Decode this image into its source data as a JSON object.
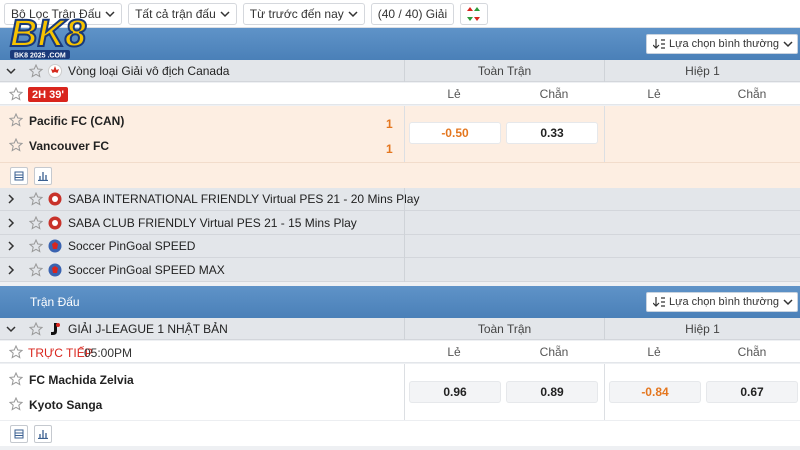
{
  "filters": {
    "match_filter": "Bộ Lọc Trận Đấu",
    "all_matches": "Tất cả trận đấu",
    "time_order": "Từ trước đến nay",
    "league_count": "(40 / 40) Giải"
  },
  "logo": {
    "text": "BK8",
    "sub": "BK8 2025 .COM"
  },
  "section1": {
    "sort_select": "Lựa chọn bình thường",
    "league": {
      "name": "Vòng loại Giải vô địch Canada",
      "col_full": "Toàn Trận",
      "col_half": "Hiệp 1"
    },
    "subhead": {
      "live_time": "2H 39'",
      "le": "Lẻ",
      "chan": "Chẵn",
      "le2": "Lẻ",
      "chan2": "Chẵn"
    },
    "match": {
      "home": "Pacific FC (CAN)",
      "away": "Vancouver FC",
      "home_score": "1",
      "away_score": "1",
      "odd_le": "-0.50",
      "odd_chan": "0.33"
    },
    "other_leagues": [
      "SABA INTERNATIONAL FRIENDLY Virtual PES 21 - 20 Mins Play",
      "SABA CLUB FRIENDLY Virtual PES 21 - 15 Mins Play",
      "Soccer PinGoal SPEED",
      "Soccer PinGoal SPEED MAX"
    ]
  },
  "section2": {
    "title": "Trận Đấu",
    "sort_select": "Lựa chọn bình thường",
    "league": {
      "name": "GIẢI J-LEAGUE 1 NHẬT BẢN",
      "col_full": "Toàn Trận",
      "col_half": "Hiệp 1"
    },
    "subhead": {
      "live_label": "TRỰC TIẾP",
      "time": "05:00PM",
      "le": "Lẻ",
      "chan": "Chẵn",
      "le2": "Lẻ",
      "chan2": "Chẵn"
    },
    "match": {
      "home": "FC Machida Zelvia",
      "away": "Kyoto Sanga",
      "odd_le": "0.96",
      "odd_chan": "0.89",
      "odd_le_h1": "-0.84",
      "odd_chan_h1": "0.67"
    }
  },
  "colors": {
    "accent_blue": "#4a80b8",
    "live_red": "#d9251d",
    "score_orange": "#e4761e",
    "highlight_row": "#fdeee2"
  }
}
